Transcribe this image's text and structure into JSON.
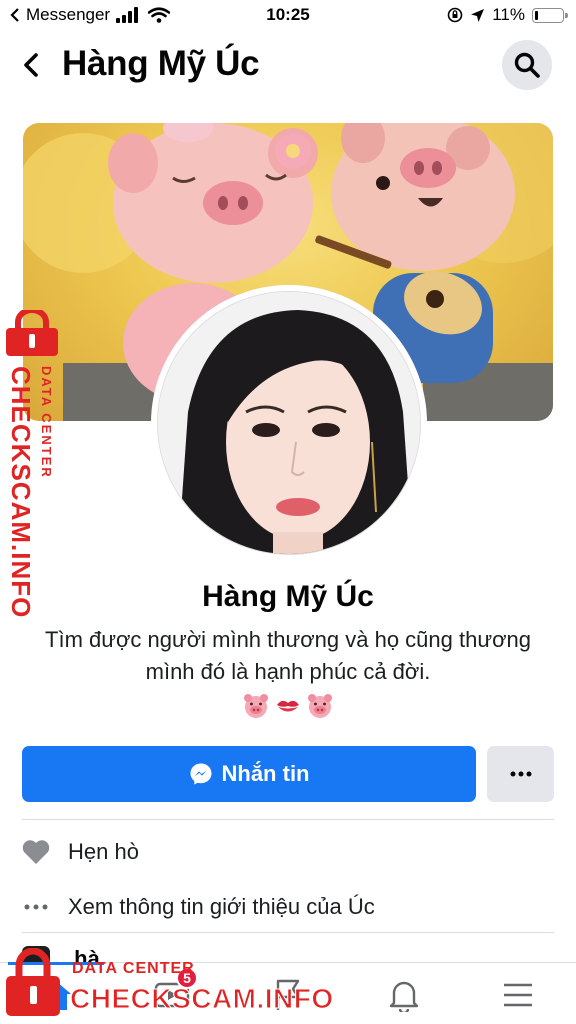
{
  "status_bar": {
    "carrier": "Messenger",
    "time": "10:25",
    "battery": "11%",
    "battery_level": 0.11
  },
  "header": {
    "title": "Hàng Mỹ Úc"
  },
  "profile": {
    "name": "Hàng Mỹ Úc",
    "bio_line1": "Tìm được người mình thương và họ cũng thương",
    "bio_line2": "mình đó là hạnh phúc cả đời.",
    "bio_emojis": [
      "pig-face-icon",
      "kiss-mark-icon",
      "pig-face-icon"
    ]
  },
  "actions": {
    "message_label": "Nhắn tin",
    "more_label": "more"
  },
  "info_rows": [
    {
      "icon": "heart-icon",
      "label": "Hẹn hò"
    },
    {
      "icon": "more-dots-icon",
      "label": "Xem thông tin giới thiệu của Úc"
    }
  ],
  "partial_row_text": "hà",
  "bottom_nav": {
    "items": [
      "home-icon",
      "video-icon",
      "flag-icon",
      "bell-icon",
      "menu-icon"
    ],
    "video_badge": "5",
    "active": "home-icon"
  },
  "watermark": {
    "small_text": "DATA CENTER",
    "big_text": "CHECKSCAM.INFO",
    "color": "#e02424"
  },
  "colors": {
    "accent": "#1877f2",
    "badge": "#e41e3f",
    "secondary_button": "#e4e6eb"
  }
}
